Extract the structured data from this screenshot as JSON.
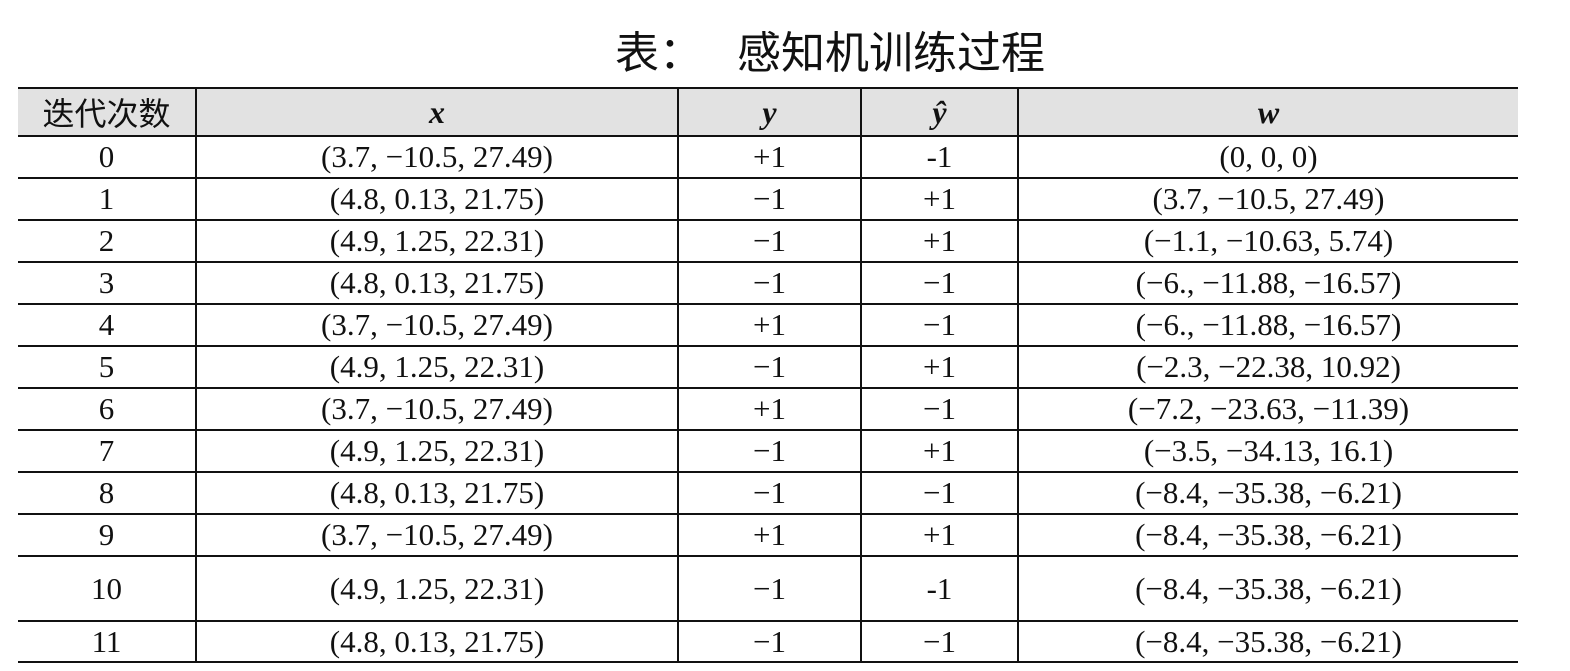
{
  "caption": {
    "label": "表：",
    "title": "感知机训练过程"
  },
  "table": {
    "headers": {
      "iteration": "迭代次数",
      "x": "x",
      "y": "y",
      "y_hat": "ŷ",
      "w": "w"
    },
    "rows": [
      {
        "iter": "0",
        "x": "(3.7, −10.5, 27.49)",
        "y": "+1",
        "y_hat": "-1",
        "w": "(0, 0, 0)"
      },
      {
        "iter": "1",
        "x": "(4.8, 0.13, 21.75)",
        "y": "−1",
        "y_hat": "+1",
        "w": "(3.7, −10.5, 27.49)"
      },
      {
        "iter": "2",
        "x": "(4.9, 1.25, 22.31)",
        "y": "−1",
        "y_hat": "+1",
        "w": "(−1.1, −10.63, 5.74)"
      },
      {
        "iter": "3",
        "x": "(4.8, 0.13, 21.75)",
        "y": "−1",
        "y_hat": "−1",
        "w": "(−6., −11.88, −16.57)"
      },
      {
        "iter": "4",
        "x": "(3.7, −10.5, 27.49)",
        "y": "+1",
        "y_hat": "−1",
        "w": "(−6., −11.88, −16.57)"
      },
      {
        "iter": "5",
        "x": "(4.9, 1.25, 22.31)",
        "y": "−1",
        "y_hat": "+1",
        "w": "(−2.3, −22.38, 10.92)"
      },
      {
        "iter": "6",
        "x": "(3.7, −10.5, 27.49)",
        "y": "+1",
        "y_hat": "−1",
        "w": "(−7.2, −23.63, −11.39)"
      },
      {
        "iter": "7",
        "x": "(4.9, 1.25, 22.31)",
        "y": "−1",
        "y_hat": "+1",
        "w": "(−3.5, −34.13, 16.1)"
      },
      {
        "iter": "8",
        "x": "(4.8, 0.13, 21.75)",
        "y": "−1",
        "y_hat": "−1",
        "w": "(−8.4, −35.38, −6.21)"
      },
      {
        "iter": "9",
        "x": "(3.7, −10.5, 27.49)",
        "y": "+1",
        "y_hat": "+1",
        "w": "(−8.4, −35.38, −6.21)"
      },
      {
        "iter": "10",
        "x": "(4.9, 1.25, 22.31)",
        "y": "−1",
        "y_hat": "-1",
        "w": "(−8.4, −35.38, −6.21)"
      },
      {
        "iter": "11",
        "x": "(4.8, 0.13, 21.75)",
        "y": "−1",
        "y_hat": "−1",
        "w": "(−8.4, −35.38, −6.21)"
      }
    ]
  }
}
